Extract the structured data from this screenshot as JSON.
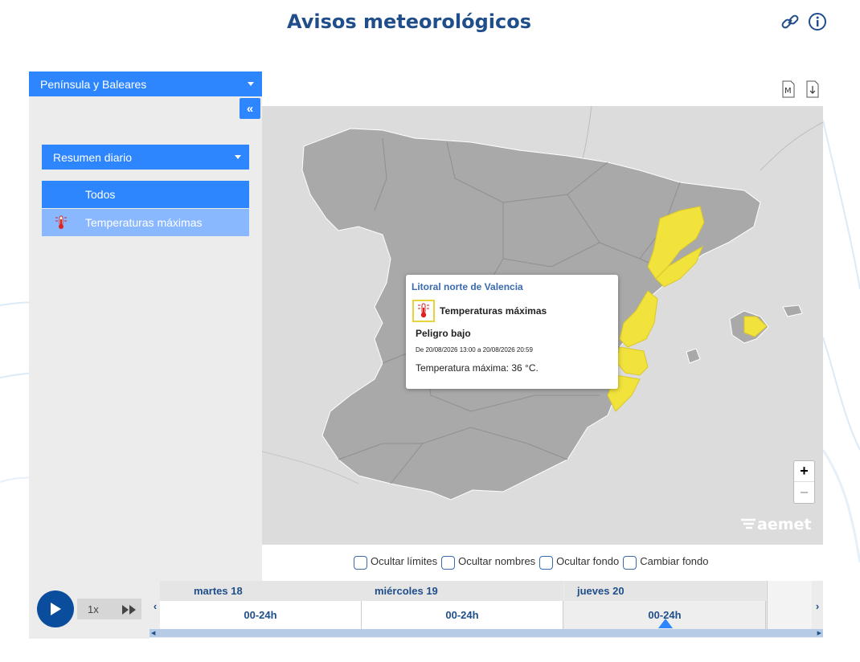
{
  "header": {
    "title": "Avisos meteorológicos",
    "icons": [
      "link-icon",
      "info-icon"
    ]
  },
  "sidebar": {
    "region_select": "Península y Baleares",
    "collapse_label": "«",
    "summary_select": "Resumen diario",
    "filters": [
      {
        "label": "Todos",
        "icon": "none"
      },
      {
        "label": "Temperaturas máximas",
        "icon": "thermometer-icon"
      }
    ]
  },
  "map": {
    "tools": [
      "map-m-icon",
      "download-icon"
    ],
    "popup": {
      "zone": "Litoral norte de Valencia",
      "warning": "Temperaturas máximas",
      "level": "Peligro bajo",
      "range": "De 20/08/2026 13:00 a 20/08/2026 20:59",
      "detail": "Temperatura máxima: 36 °C."
    },
    "zoom_in": "+",
    "zoom_out": "−",
    "logo": "aemet",
    "colors": {
      "land": "#a9a9a9",
      "sea": "#dcdcdc",
      "warning_yellow": "#f1e23c"
    }
  },
  "options": [
    {
      "label": "Ocultar límites",
      "checked": false
    },
    {
      "label": "Ocultar nombres",
      "checked": false
    },
    {
      "label": "Ocultar fondo",
      "checked": false
    },
    {
      "label": "Cambiar fondo",
      "checked": false
    }
  ],
  "player": {
    "speed": "1x"
  },
  "timeline": {
    "days": [
      {
        "label": "martes 18",
        "slot": "00-24h",
        "selected": false
      },
      {
        "label": "miércoles 19",
        "slot": "00-24h",
        "selected": false
      },
      {
        "label": "jueves 20",
        "slot": "00-24h",
        "selected": true
      }
    ],
    "prev": "‹",
    "next": "›"
  }
}
